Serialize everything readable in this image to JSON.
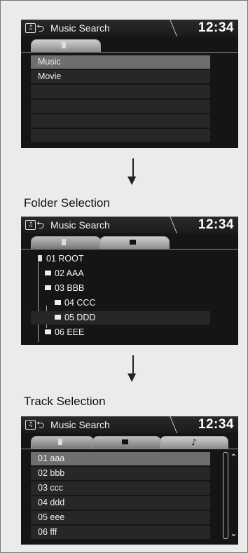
{
  "screens": [
    {
      "title": "Music Search",
      "clock": "12:34",
      "tabs": [
        "usb-icon"
      ],
      "items": [
        {
          "label": "Music",
          "selected": true
        },
        {
          "label": "Movie",
          "selected": false
        },
        {
          "label": "",
          "selected": false
        },
        {
          "label": "",
          "selected": false
        },
        {
          "label": "",
          "selected": false
        },
        {
          "label": "",
          "selected": false
        }
      ]
    },
    {
      "caption": "Folder Selection",
      "title": "Music Search",
      "clock": "12:34",
      "tabs": [
        "usb-icon",
        "folder-icon"
      ],
      "items": [
        {
          "label": "01 ROOT",
          "level": 0,
          "icon": "usb-icon"
        },
        {
          "label": "02 AAA",
          "level": 1,
          "icon": "folder-icon"
        },
        {
          "label": "03 BBB",
          "level": 1,
          "icon": "folder-icon"
        },
        {
          "label": "04 CCC",
          "level": 2,
          "icon": "folder-icon"
        },
        {
          "label": "05 DDD",
          "level": 2,
          "icon": "folder-icon",
          "selected": true
        },
        {
          "label": "06 EEE",
          "level": 1,
          "icon": "folder-icon"
        }
      ]
    },
    {
      "caption": "Track Selection",
      "title": "Music Search",
      "clock": "12:34",
      "tabs": [
        "usb-icon",
        "folder-icon",
        "music-note-icon"
      ],
      "items": [
        {
          "label": "01 aaa",
          "selected": true
        },
        {
          "label": "02 bbb"
        },
        {
          "label": "03 ccc"
        },
        {
          "label": "04 ddd"
        },
        {
          "label": "05 eee"
        },
        {
          "label": "06 fff"
        }
      ]
    }
  ],
  "colors": {
    "screen_bg": "#151515",
    "row_bg": "#272727",
    "row_selected": "#6e6e6e",
    "text": "#f2f2f2"
  }
}
